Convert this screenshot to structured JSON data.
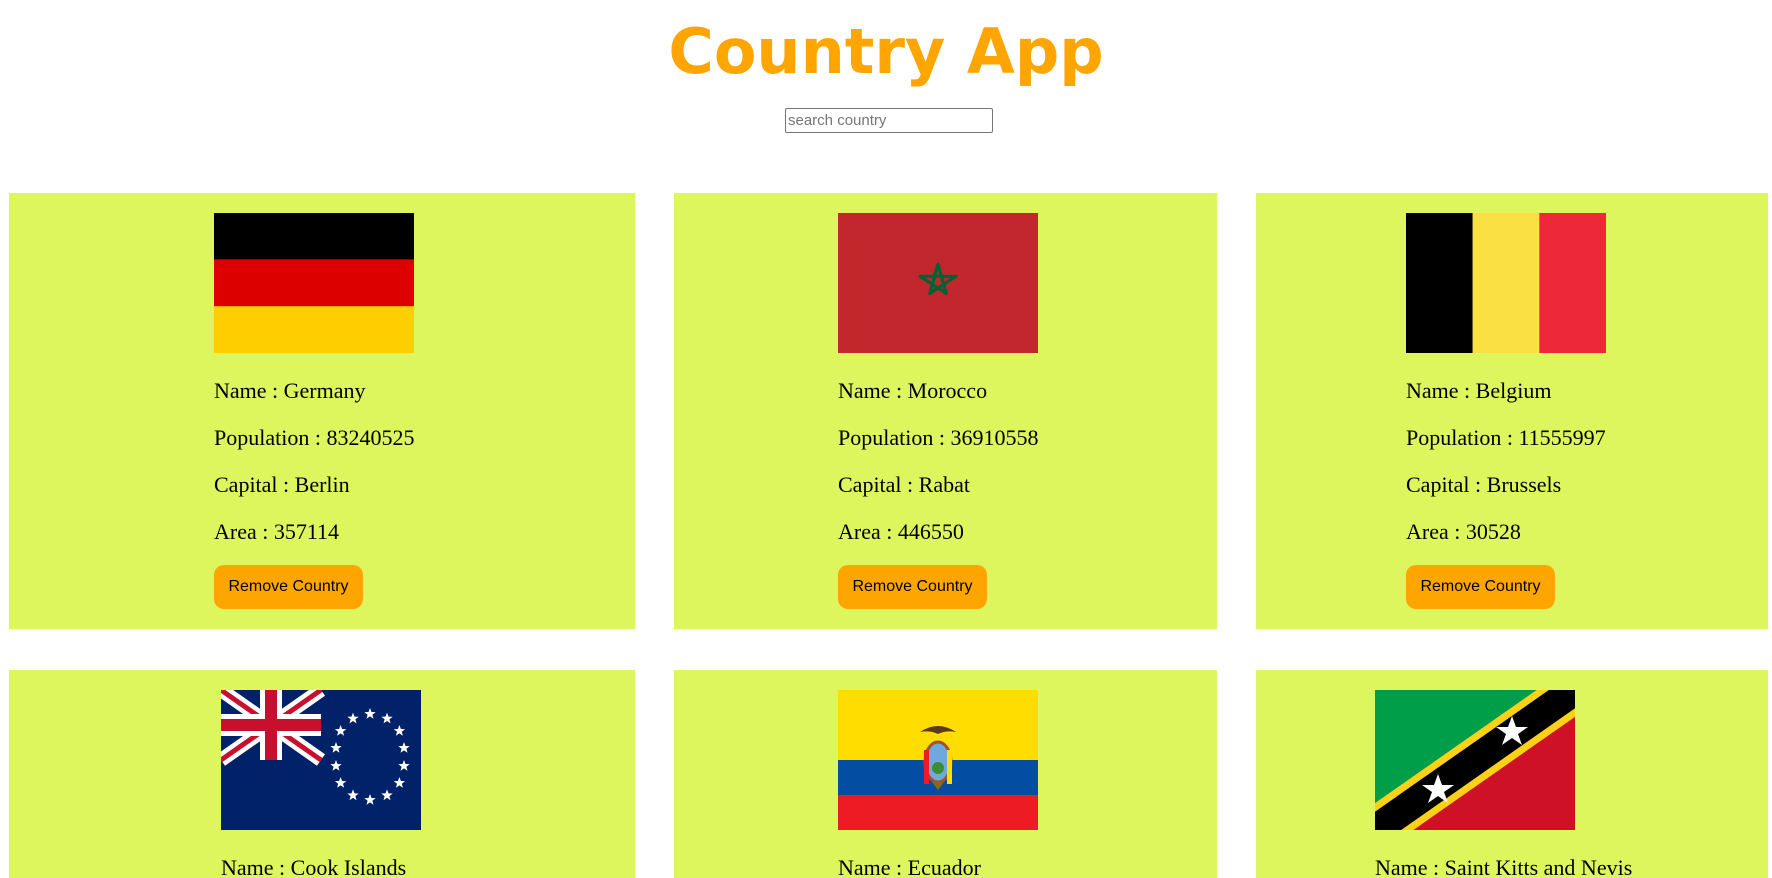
{
  "header": {
    "title": "Country App"
  },
  "search": {
    "placeholder": "search country",
    "value": ""
  },
  "labels": {
    "name": "Name : ",
    "population": "Population : ",
    "capital": "Capital : ",
    "area": "Area : ",
    "remove_button": "Remove Country"
  },
  "colors": {
    "accent": "#FFA500",
    "card_background": "#DDF65D"
  },
  "countries": [
    {
      "name": "Germany",
      "population": "83240525",
      "capital": "Berlin",
      "area": "357114",
      "flag_icon": "germany-flag-icon"
    },
    {
      "name": "Morocco",
      "population": "36910558",
      "capital": "Rabat",
      "area": "446550",
      "flag_icon": "morocco-flag-icon"
    },
    {
      "name": "Belgium",
      "population": "11555997",
      "capital": "Brussels",
      "area": "30528",
      "flag_icon": "belgium-flag-icon"
    },
    {
      "name": "Cook Islands",
      "flag_icon": "cook-islands-flag-icon"
    },
    {
      "name": "Ecuador",
      "flag_icon": "ecuador-flag-icon"
    },
    {
      "name": "Saint Kitts and Nevis",
      "flag_icon": "saint-kitts-and-nevis-flag-icon"
    }
  ]
}
